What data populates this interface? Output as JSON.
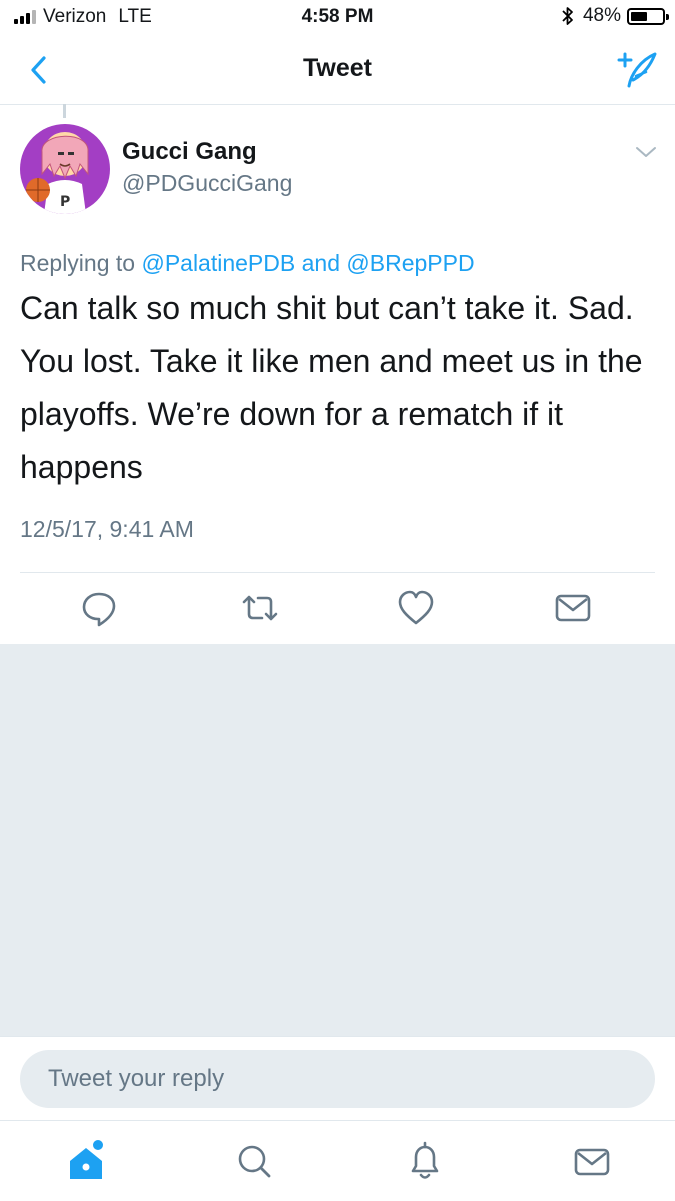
{
  "status_bar": {
    "carrier": "Verizon",
    "network": "LTE",
    "time": "4:58 PM",
    "battery": "48%",
    "battery_level": 0.48
  },
  "nav": {
    "title": "Tweet",
    "back_icon": "chevron-left-icon",
    "compose_icon": "compose-tweet-icon"
  },
  "tweet": {
    "display_name": "Gucci Gang",
    "handle": "@PDGucciGang",
    "reply_prefix": "Replying to",
    "reply_user_1": "@PalatinePDB",
    "reply_and": "and",
    "reply_user_2": "@BRepPPD",
    "text": "Can talk so much shit but can’t take it. Sad. You lost. Take it like men and meet us in the playoffs. We’re down for a rematch if it happens",
    "timestamp": "12/5/17, 9:41 AM"
  },
  "actions": [
    "reply-icon",
    "retweet-icon",
    "like-icon",
    "direct-message-icon"
  ],
  "reply_bar": {
    "placeholder": "Tweet your reply"
  },
  "tab_bar": [
    "home-icon",
    "search-icon",
    "notifications-icon",
    "messages-icon"
  ],
  "colors": {
    "accent": "#1da1f2",
    "secondary_text": "#657786",
    "background_gray": "#e6ecf0",
    "avatar_bg": "#a33ec4"
  }
}
